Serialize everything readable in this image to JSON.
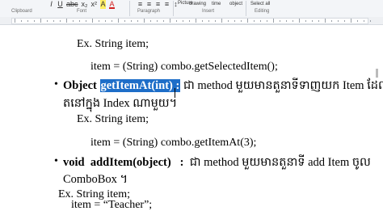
{
  "ribbon": {
    "format_icons": [
      "I",
      "U",
      "abc",
      "x₂",
      "x²",
      "A",
      "A"
    ],
    "insert_labels": [
      "drawing",
      "time",
      "object"
    ],
    "insert_pre": "Picture",
    "editing_label": "Select all",
    "groups": {
      "clipboard": "Clipboard",
      "font": "Font",
      "paragraph": "Paragraph",
      "insert": "Insert",
      "editing": "Editing"
    }
  },
  "document": {
    "lines": {
      "ex1": "Ex. String item;",
      "code1": "item = (String) combo.getSelectedItem();",
      "b1_type": "Object",
      "b1_method": "getItemAt(int) :",
      "b1_desc": "ជា method មួយមានតួនាទីទាញយក Item ដែលស្ថិ",
      "b1_desc2": "តនៅក្នុង Index ណាមួយ។",
      "ex2": "Ex. String item;",
      "code2": "item = (String) combo.getItemAt(3);",
      "b2_type": "void",
      "b2_method": "addItem(object)",
      "b2_colon": ":",
      "b2_desc": "ជា method មួយមានតួនាទី add Item ចូល",
      "b2_desc2": "ComboBox ។",
      "ex3": "Ex. String item;",
      "code3": "item = “Teacher”;"
    },
    "bullet_char": "•"
  }
}
